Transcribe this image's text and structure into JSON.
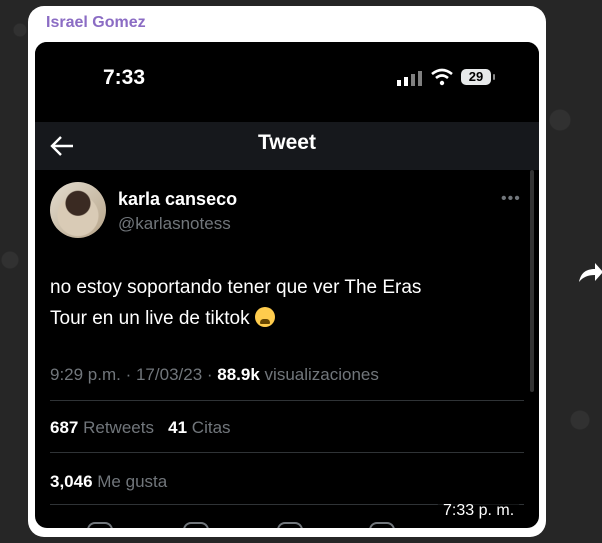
{
  "chat": {
    "sender": "Israel Gomez",
    "message_time": "7:33 p. m."
  },
  "phone": {
    "clock": "7:33",
    "battery": "29"
  },
  "tweet_screen": {
    "header_title": "Tweet",
    "author": {
      "display_name": "karla canseco",
      "handle": "@karlasnotess"
    },
    "text_line1": "no estoy soportando tener que ver The Eras",
    "text_line2": "Tour en un live de tiktok",
    "emoji": "loudly-crying-face",
    "timestamp": "9:29 p.m. · 17/03/23 · ",
    "views_count": "88.9k",
    "views_label": " visualizaciones",
    "retweets_count": "687",
    "retweets_label": " Retweets",
    "quotes_count": "41",
    "quotes_label": " Citas",
    "likes_count": "3,046",
    "likes_label": " Me gusta"
  },
  "icons": {
    "back": "back-arrow-icon",
    "more": "more-options-icon",
    "forward": "forward-share-icon"
  },
  "colors": {
    "sender_name": "#8b6cc4",
    "bubble": "#ffffff",
    "tweet_bg": "#000000",
    "muted_text": "#71767b"
  }
}
